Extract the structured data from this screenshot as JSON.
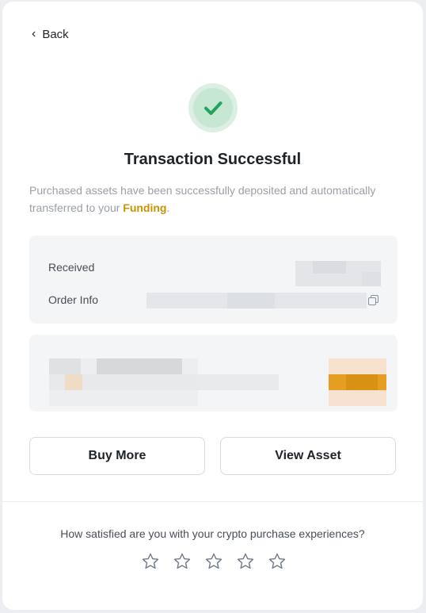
{
  "nav": {
    "back_label": "Back"
  },
  "status": {
    "title": "Transaction Successful",
    "description_prefix": "Purchased assets have been successfully deposited and automatically transferred to your ",
    "funding_link": "Funding",
    "description_suffix": "."
  },
  "details": {
    "received_label": "Received",
    "order_info_label": "Order Info"
  },
  "actions": {
    "buy_more": "Buy More",
    "view_asset": "View Asset"
  },
  "survey": {
    "question": "How satisfied are you with your crypto purchase experiences?",
    "star_count": 5
  },
  "colors": {
    "success_green": "#1fa55b",
    "brand_gold": "#c99400"
  }
}
